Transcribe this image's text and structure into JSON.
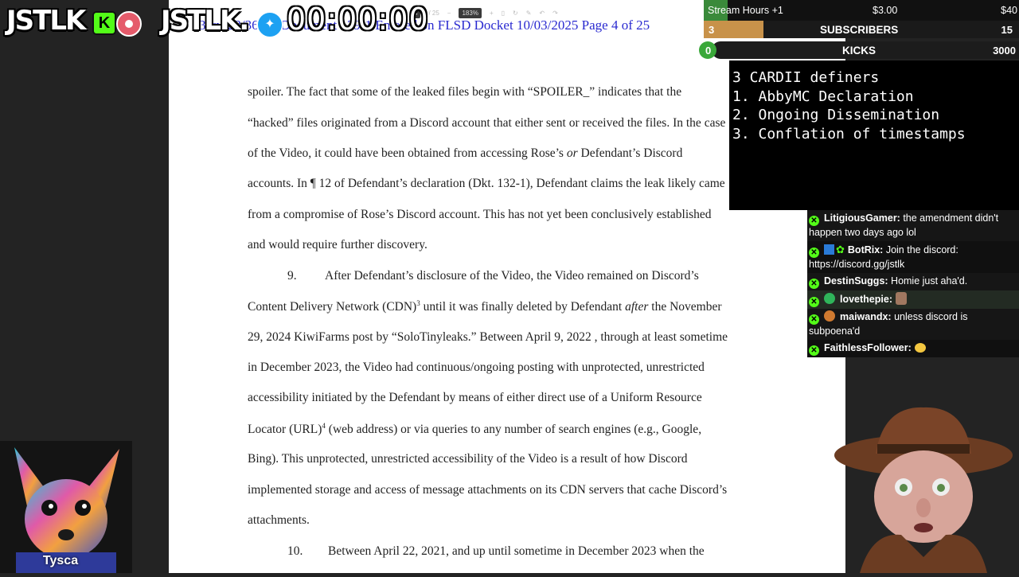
{
  "overlay": {
    "logo_left": "JSTLK",
    "kick_badge": "K",
    "logo_right": "JSTLK.",
    "timer": "00:00:00",
    "stats": {
      "stream_hours_label": "Stream Hours +1",
      "stream_hours_amount": "$3.00",
      "stream_hours_goal": "$40",
      "subscribers_count": "3",
      "subscribers_label": "SUBSCRIBERS",
      "subscribers_goal": "15",
      "kicks_count": "0",
      "kicks_label": "KICKS",
      "kicks_goal": "3000"
    },
    "notes": {
      "title": "3 CARDII definers",
      "item1": "1. AbbyMC Declaration",
      "item2": "2. Ongoing Dissemination",
      "item3": "3. Conflation of timestamps"
    },
    "avatar_name": "Tysca"
  },
  "pdf_toolbar": {
    "page_current": "4",
    "page_total": "/ 25",
    "zoom": "183%"
  },
  "document": {
    "header": "3-cv-23/36-JB    Document 139-1    Entered on FLSD Docket 10/03/2025    Page 4 of 25",
    "lines": {
      "l1": "spoiler. The fact that some of the leaked files begin with “SPOILER_” indicates that the",
      "l2": "“hacked” files originated from a Discord account that either sent or received the files. In the case",
      "l3a": "of the Video, it could have been obtained from accessing Rose’s ",
      "l3b": "or",
      "l3c": " Defendant’s Discord",
      "l4": "accounts. In ¶ 12 of Defendant’s declaration (Dkt. 132-1), Defendant claims the leak likely came",
      "l5": "from a compromise of Rose’s Discord account. This has not yet been conclusively established",
      "l6": "and would require further discovery.",
      "l7num": "9.",
      "l7": "After Defendant’s disclosure of the Video, the Video remained on Discord’s",
      "l8a": "Content Delivery Network (CDN)",
      "l8sup": "3",
      "l8b": " until it was finally deleted by Defendant ",
      "l8c": "after",
      "l8d": " the November",
      "l9": "29, 2024 KiwiFarms post by “SoloTinyleaks.” Between April 9, 2022 , through at least sometime",
      "l10": "in December 2023, the Video had continuous/ongoing posting with unprotected, unrestricted",
      "l11": "accessibility initiated by the Defendant by means of either direct use of a Uniform Resource",
      "l12a": "Locator (URL)",
      "l12sup": "4",
      "l12b": " (web address) or via queries to any number of search engines (e.g., Google,",
      "l13": "Bing).  This unprotected, unrestricted accessibility of the Video is a result of how Discord",
      "l14": "implemented storage and access of message attachments on its CDN servers that cache Discord’s",
      "l15": "attachments.",
      "l16num": "10.",
      "l16": "Between April 22, 2021, and up until sometime in December  2023 when the"
    }
  },
  "chat": {
    "m1": {
      "name": "LitigiousGamer:",
      "text": " the amendment didn't happen two days ago lol"
    },
    "m2": {
      "name": "BotRix:",
      "text": " Join the discord: https://discord.gg/jstlk"
    },
    "m3": {
      "name": "DestinSuggs:",
      "text": " Homie just aha'd."
    },
    "m4": {
      "name": "lovethepie:",
      "text": ""
    },
    "m5": {
      "name": "maiwandx:",
      "text": " unless discord is subpoena'd"
    },
    "m6": {
      "name": "FaithlessFollower:",
      "text": ""
    }
  },
  "colors": {
    "kick_green": "#53fc18",
    "stats_bar": "#3a8a3a",
    "sub_bar": "#c8924a"
  }
}
